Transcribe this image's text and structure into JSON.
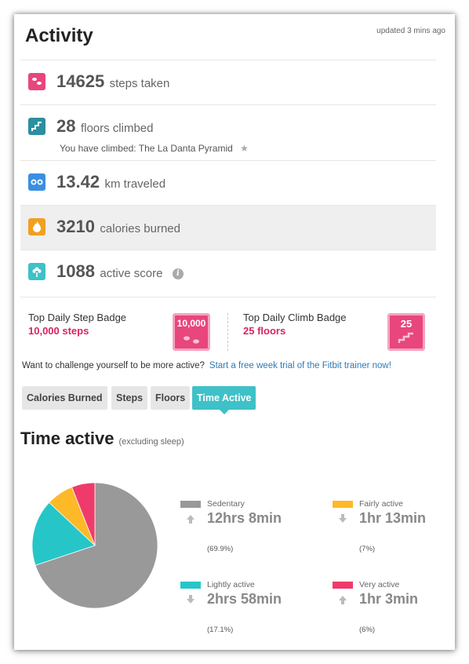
{
  "header": {
    "title": "Activity",
    "updated": "updated 3 mins ago"
  },
  "stats": [
    {
      "icon": "footsteps-icon",
      "color": "#e8467d",
      "value": "14625",
      "unit": "steps taken"
    },
    {
      "icon": "stairs-icon",
      "color": "#2a8fa0",
      "value": "28",
      "unit": "floors climbed",
      "sub": "You have climbed: The La Danta Pyramid",
      "sub_icon": "★"
    },
    {
      "icon": "odometer-icon",
      "color": "#3a8fe0",
      "value": "13.42",
      "unit": "km traveled"
    },
    {
      "icon": "flame-icon",
      "color": "#f0a020",
      "value": "3210",
      "unit": "calories burned"
    },
    {
      "icon": "flower-icon",
      "color": "#3ec1c7",
      "value": "1088",
      "unit": "active score",
      "info": "i"
    }
  ],
  "badges": {
    "step": {
      "label": "Top Daily Step Badge",
      "goal": "10,000 steps",
      "badge_text": "10,000"
    },
    "climb": {
      "label": "Top Daily Climb Badge",
      "goal": "25 floors",
      "badge_text": "25"
    }
  },
  "challenge": {
    "text": "Want to challenge yourself to be more active?",
    "link": "Start a free week trial of the Fitbit trainer now!"
  },
  "tabs": [
    {
      "label": "Calories Burned",
      "active": false
    },
    {
      "label": "Steps",
      "active": false
    },
    {
      "label": "Floors",
      "active": false
    },
    {
      "label": "Time Active",
      "active": true
    }
  ],
  "time_active": {
    "title": "Time active",
    "subtitle": "(excluding sleep)"
  },
  "chart_data": {
    "type": "pie",
    "title": "",
    "series": [
      {
        "name": "Sedentary",
        "value": 69.9,
        "duration": "12hrs 8min",
        "percent": "(69.9%)",
        "color": "#999999",
        "trend": "up"
      },
      {
        "name": "Lightly active",
        "value": 17.1,
        "duration": "2hrs 58min",
        "percent": "(17.1%)",
        "color": "#26c6c8",
        "trend": "down"
      },
      {
        "name": "Fairly active",
        "value": 7,
        "duration": "1hr 13min",
        "percent": "(7%)",
        "color": "#fdb927",
        "trend": "down"
      },
      {
        "name": "Very active",
        "value": 6,
        "duration": "1hr 3min",
        "percent": "(6%)",
        "color": "#ef3b6b",
        "trend": "up"
      }
    ]
  }
}
